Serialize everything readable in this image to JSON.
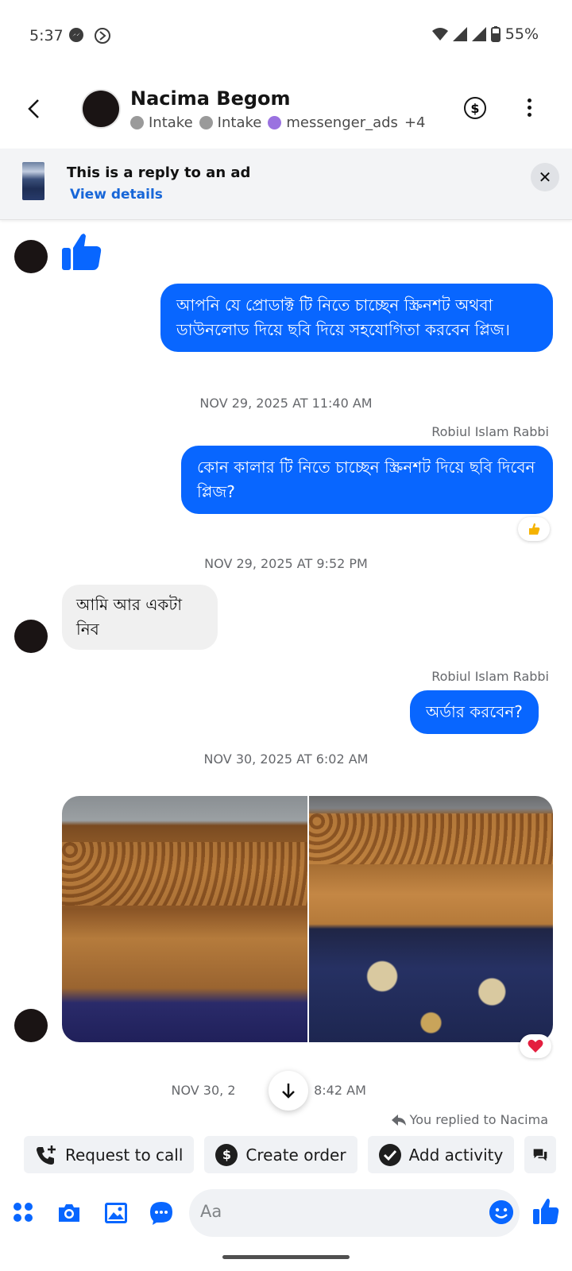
{
  "status_bar": {
    "time": "5:37",
    "battery": "55%"
  },
  "header": {
    "contact_name": "Nacima Begom",
    "tags": [
      {
        "label": "Intake",
        "color": "#9a9a9a"
      },
      {
        "label": "Intake",
        "color": "#9a9a9a"
      },
      {
        "label": "messenger_ads",
        "color": "#9a72e0"
      }
    ],
    "more_tags": "+4",
    "dollar_symbol": "$"
  },
  "ad_banner": {
    "title": "This is a reply to an ad",
    "link": "View details"
  },
  "messages": {
    "msg1": "আপনি যে প্রোডাক্ট টি নিতে চাচ্ছেন স্ক্রিনশট অথবা ডাউনলোড দিয়ে ছবি দিয়ে সহযোগিতা করবেন প্লিজ।",
    "ts1": "NOV 29, 2025 AT 11:40 AM",
    "sender1": "Robiul Islam Rabbi",
    "msg2": "কোন কালার টি নিতে চাচ্ছেন স্ক্রিনশট দিয়ে ছবি দিবেন প্লিজ?",
    "ts2": "NOV 29, 2025 AT 9:52 PM",
    "msg3": "আমি আর একটা নিব",
    "sender2": "Robiul Islam Rabbi",
    "msg4": "অর্ডার করবেন?",
    "ts3": "NOV 30, 2025 AT 6:02 AM",
    "ts4_left": "NOV 30, 2",
    "ts4_right": "8:42 AM",
    "replied": "You replied to Nacima"
  },
  "chips": {
    "call": "Request to call",
    "order": "Create order",
    "activity": "Add activity"
  },
  "composer": {
    "placeholder": "Aa"
  },
  "colors": {
    "accent": "#0866ff",
    "incoming_bubble": "#f0f0f0",
    "heart": "#e41e3f"
  }
}
